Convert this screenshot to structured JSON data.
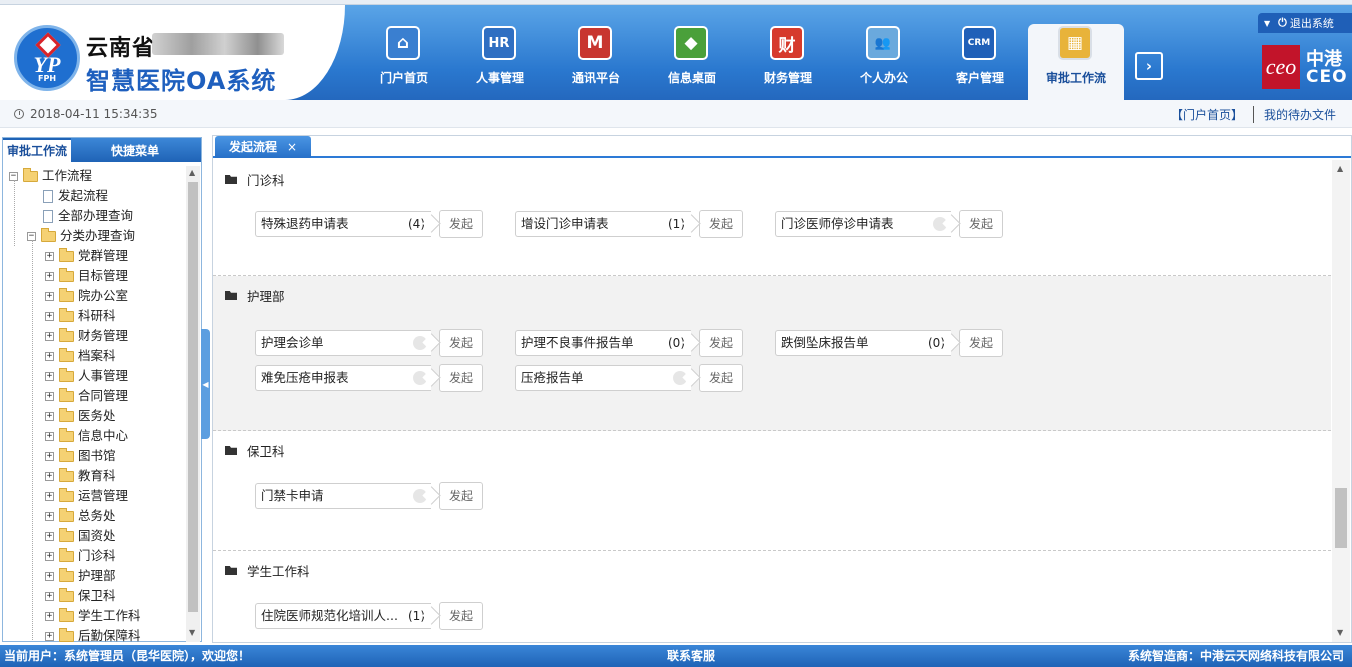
{
  "header": {
    "logo_abbr": "FPH",
    "logo_letters": "YP",
    "title_line1": "云南省",
    "title_line2": "智慧医院OA系统",
    "logout_label": "退出系统",
    "brand_cn": "中港",
    "brand_en": "CEO",
    "brand_icon": "seal-icon"
  },
  "nav": {
    "items": [
      {
        "label": "门户首页",
        "icon": "home-icon",
        "glyph": "⌂",
        "color": "#3a7fd0"
      },
      {
        "label": "人事管理",
        "icon": "hr-icon",
        "glyph": "HR",
        "color": "#2f6fc2"
      },
      {
        "label": "通讯平台",
        "icon": "mail-icon",
        "glyph": "M",
        "color": "#c8362f"
      },
      {
        "label": "信息桌面",
        "icon": "desktop-icon",
        "glyph": "◆",
        "color": "#4aa03a"
      },
      {
        "label": "财务管理",
        "icon": "finance-icon",
        "glyph": "财",
        "color": "#d63a2c"
      },
      {
        "label": "个人办公",
        "icon": "people-icon",
        "glyph": "👥",
        "color": "#6aa9dd"
      },
      {
        "label": "客户管理",
        "icon": "crm-icon",
        "glyph": "CRM",
        "color": "#2060b8"
      },
      {
        "label": "审批工作流",
        "icon": "workflow-icon",
        "glyph": "▦",
        "color": "#e8b33a"
      }
    ],
    "active_index": 7
  },
  "subbar": {
    "datetime": "2018-04-11 15:34:35",
    "link_portal": "【门户首页】",
    "link_todo": "我的待办文件"
  },
  "left_panel": {
    "tabs": [
      "审批工作流",
      "快捷菜单"
    ],
    "tree": {
      "root": "工作流程",
      "children": [
        "发起流程",
        "全部办理查询"
      ],
      "category_root": "分类办理查询",
      "categories": [
        "党群管理",
        "目标管理",
        "院办公室",
        "科研科",
        "财务管理",
        "档案科",
        "人事管理",
        "合同管理",
        "医务处",
        "信息中心",
        "图书馆",
        "教育科",
        "运营管理",
        "总务处",
        "国资处",
        "门诊科",
        "护理部",
        "保卫科",
        "学生工作科",
        "后勤保障科"
      ]
    }
  },
  "right_panel": {
    "tab_label": "发起流程",
    "tab_close": "×",
    "launch_label": "发起",
    "sections": [
      {
        "title": "门诊科",
        "flows": [
          {
            "name": "特殊退药申请表",
            "count": "(4)"
          },
          {
            "name": "增设门诊申请表",
            "count": "(1)"
          },
          {
            "name": "门诊医师停诊申请表",
            "count": ""
          }
        ]
      },
      {
        "title": "护理部",
        "flows": [
          {
            "name": "护理会诊单",
            "count": ""
          },
          {
            "name": "护理不良事件报告单",
            "count": "(0)"
          },
          {
            "name": "跌倒坠床报告单",
            "count": "(0)"
          },
          {
            "name": "难免压疮申报表",
            "count": ""
          },
          {
            "name": "压疮报告单",
            "count": ""
          }
        ]
      },
      {
        "title": "保卫科",
        "flows": [
          {
            "name": "门禁卡申请",
            "count": ""
          }
        ]
      },
      {
        "title": "学生工作科",
        "flows": [
          {
            "name": "住院医师规范化培训人...",
            "count": "(1)"
          }
        ]
      }
    ]
  },
  "footer": {
    "current_user": "当前用户：系统管理员（昆华医院），欢迎您！",
    "contact": "联系客服",
    "vendor": "系统智造商：中港云天网络科技有限公司"
  }
}
